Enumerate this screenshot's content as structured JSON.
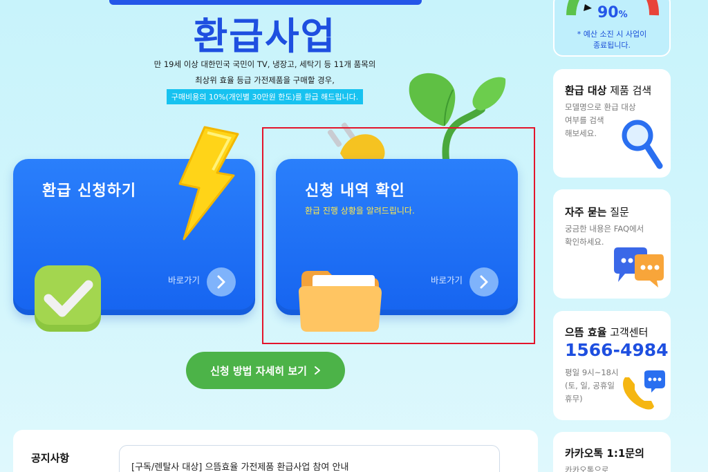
{
  "hero": {
    "title": "환급사업",
    "desc_line1": "만 19세 이상 대한민국 국민이 TV, 냉장고, 세탁기 등 11개 품목의",
    "desc_line2": "최상위 효율 등급 가전제품을 구매할 경우,",
    "highlight": "구매비용의 10%(개인별 30만원 한도)를 환급 해드립니다."
  },
  "cards": [
    {
      "title": "환급 신청하기",
      "subtitle": "",
      "go_label": "바로가기"
    },
    {
      "title": "신청 내역 확인",
      "subtitle": "환급 진행 상황을 알려드립니다.",
      "go_label": "바로가기"
    }
  ],
  "cta": {
    "label": "신청 방법 자세히 보기"
  },
  "notice": {
    "title": "공지사항",
    "items": [
      "[구독/렌탈사 대상] 으뜸효율 가전제품 환급사업 참여 안내"
    ]
  },
  "sidebar": {
    "budget": {
      "value": "90",
      "unit": "%",
      "note_line1": "* 예산 소진 시 사업이",
      "note_line2": "종료됩니다."
    },
    "search": {
      "title_bold": "환급 대상",
      "title_rest": " 제품 검색",
      "desc_lines": [
        "모델명으로 환급 대상",
        "여부를 검색",
        "해보세요."
      ]
    },
    "faq": {
      "title_bold": "자주 묻는",
      "title_rest": " 질문",
      "desc_lines": [
        "궁금한 내용은 FAQ에서",
        "확인하세요."
      ]
    },
    "center": {
      "title_bold": "으뜸 효율",
      "title_rest": " 고객센터",
      "phone": "1566-4984",
      "desc_lines": [
        "평일 9시~18시",
        "(토, 일, 공휴일",
        "휴무)"
      ]
    },
    "kakao": {
      "title": "카카오톡 1:1문의",
      "desc": "카카오톡으로"
    }
  },
  "colors": {
    "primary": "#1e4fe0",
    "card_blue": "#1664f0",
    "cta_green": "#4cb348",
    "highlight_red": "#e3142a"
  }
}
